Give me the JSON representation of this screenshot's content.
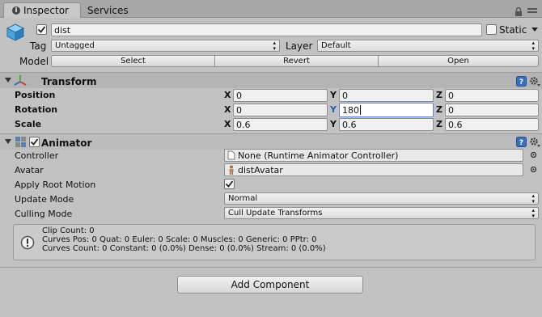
{
  "tabs": {
    "inspector": "Inspector",
    "services": "Services"
  },
  "object": {
    "name": "dist",
    "static_label": "Static",
    "tag_label": "Tag",
    "tag_value": "Untagged",
    "layer_label": "Layer",
    "layer_value": "Default",
    "model_label": "Model",
    "select": "Select",
    "revert": "Revert",
    "open": "Open"
  },
  "transform": {
    "title": "Transform",
    "position_label": "Position",
    "rotation_label": "Rotation",
    "scale_label": "Scale",
    "axis_x": "X",
    "axis_y": "Y",
    "axis_z": "Z",
    "position": {
      "x": "0",
      "y": "0",
      "z": "0"
    },
    "rotation": {
      "x": "0",
      "y": "180",
      "z": "0"
    },
    "scale": {
      "x": "0.6",
      "y": "0.6",
      "z": "0.6"
    }
  },
  "animator": {
    "title": "Animator",
    "controller_label": "Controller",
    "controller_value": "None (Runtime Animator Controller)",
    "avatar_label": "Avatar",
    "avatar_value": "distAvatar",
    "apply_root_motion_label": "Apply Root Motion",
    "update_mode_label": "Update Mode",
    "update_mode_value": "Normal",
    "culling_mode_label": "Culling Mode",
    "culling_mode_value": "Cull Update Transforms",
    "info_lines": [
      "Clip Count: 0",
      "Curves Pos: 0 Quat: 0 Euler: 0 Scale: 0 Muscles: 0 Generic: 0 PPtr: 0",
      "Curves Count: 0 Constant: 0 (0.0%) Dense: 0 (0.0%) Stream: 0 (0.0%)"
    ]
  },
  "add_component": "Add Component",
  "colors": {
    "background": "#c2c2c2",
    "accent_blue": "#2a5db0",
    "help_icon": "#3a6fbf"
  }
}
